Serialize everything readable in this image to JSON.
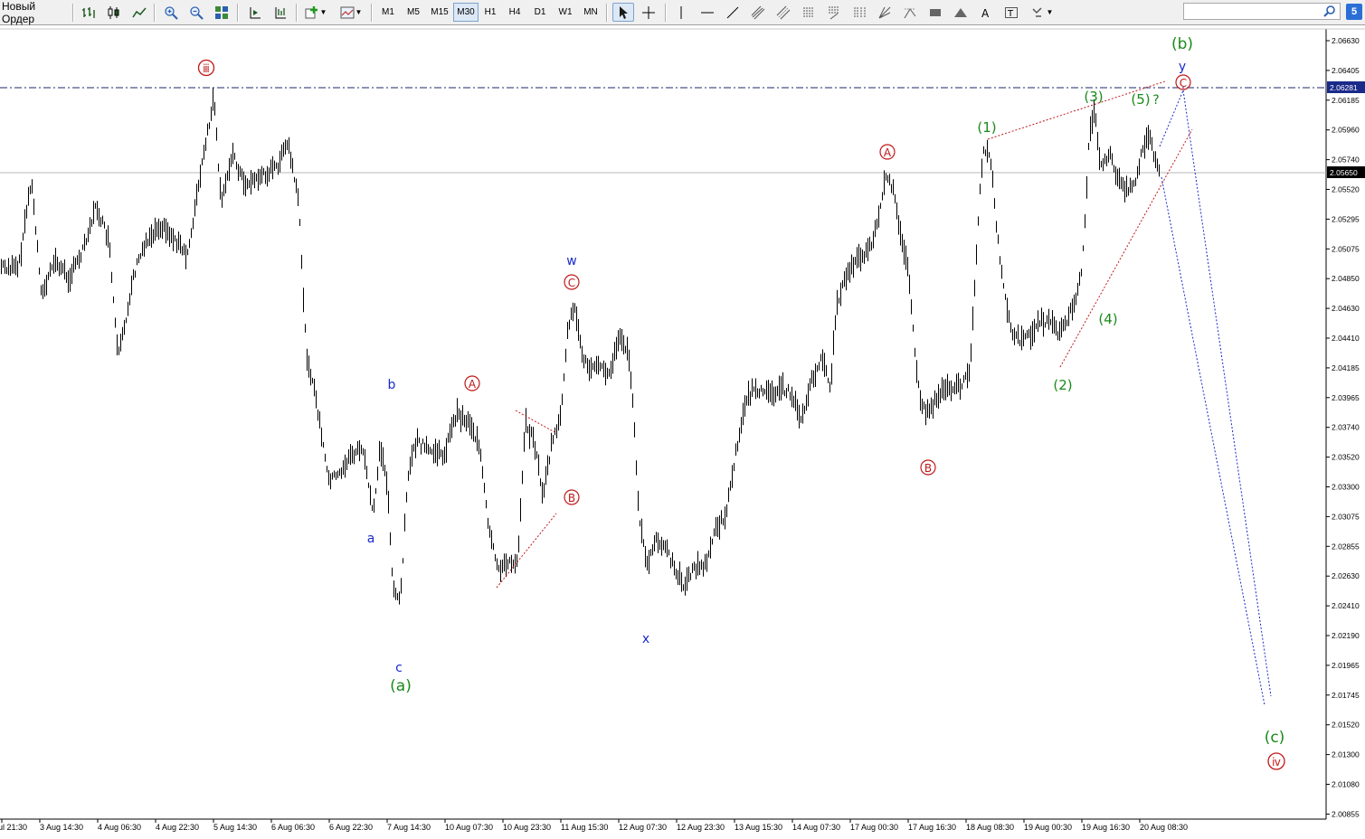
{
  "toolbar": {
    "new_order": "Новый Ордер",
    "timeframes": [
      "M1",
      "M5",
      "M15",
      "M30",
      "H1",
      "H4",
      "D1",
      "W1",
      "MN"
    ],
    "active_timeframe": "M30",
    "search_value": "",
    "messages_count": "5"
  },
  "chart": {
    "price_axis": [
      "2.06630",
      "2.06405",
      "2.06185",
      "2.05960",
      "2.05740",
      "2.05520",
      "2.05295",
      "2.05075",
      "2.04850",
      "2.04630",
      "2.04410",
      "2.04185",
      "2.03965",
      "2.03740",
      "2.03520",
      "2.03300",
      "2.03075",
      "2.02855",
      "2.02630",
      "2.02410",
      "2.02190",
      "2.01965",
      "2.01745",
      "2.01520",
      "2.01300",
      "2.01080",
      "2.00855"
    ],
    "resistance_price": "2.06281",
    "current_price": "2.05650",
    "time_axis": [
      "ul 21:30",
      "3 Aug 14:30",
      "4 Aug 06:30",
      "4 Aug 22:30",
      "5 Aug 14:30",
      "6 Aug 06:30",
      "6 Aug 22:30",
      "7 Aug 14:30",
      "10 Aug 07:30",
      "10 Aug 23:30",
      "11 Aug 15:30",
      "12 Aug 07:30",
      "12 Aug 23:30",
      "13 Aug 15:30",
      "14 Aug 07:30",
      "17 Aug 00:30",
      "17 Aug 16:30",
      "18 Aug 08:30",
      "19 Aug 00:30",
      "19 Aug 16:30",
      "20 Aug 08:30"
    ],
    "labels": {
      "iii": "ⅲ",
      "a_paren": "(a)",
      "b_paren": "(b)",
      "c_paren": "(c)",
      "iv": "ⅳ",
      "a_small": "a",
      "b_small": "b",
      "c_small": "c",
      "w": "w",
      "x": "x",
      "y": "y",
      "A1": "A",
      "C1": "C",
      "B1": "B",
      "A2": "A",
      "B2": "B",
      "C2": "C",
      "w1": "(1)",
      "w2": "(2)",
      "w3": "(3)",
      "w4": "(4)",
      "w5": "(5)",
      "question": "?"
    },
    "colors": {
      "wave_green": "#1a8a1a",
      "wave_red": "#c01818",
      "wave_blue": "#1a2acc",
      "bars": "#000000",
      "current_label_bg": "#000000",
      "resistance_label_bg": "#1a2a8a"
    }
  }
}
